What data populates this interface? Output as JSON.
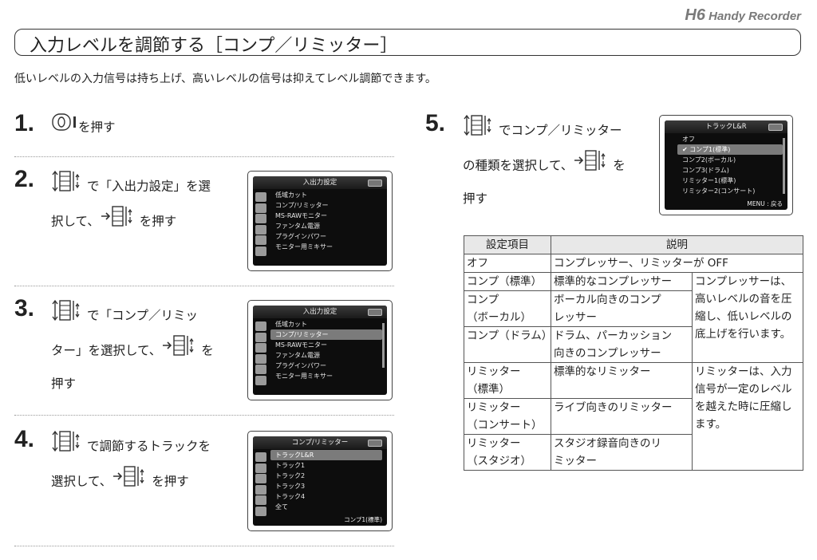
{
  "brand": {
    "model": "H6",
    "name": "Handy Recorder"
  },
  "title": "入力レベルを調節する［コンプ／リミッター］",
  "intro": "低いレベルの入力信号は持ち上げ、高いレベルの信号は抑えてレベル調節できます。",
  "steps": [
    {
      "num": "1.",
      "lines": [
        "を押す"
      ]
    },
    {
      "num": "2.",
      "lines": [
        "で「入出力設定」を選",
        "択して、",
        "を押す"
      ]
    },
    {
      "num": "3.",
      "lines": [
        "で「コンプ／リミッ",
        "ター」を選択して、",
        "を",
        "押す"
      ]
    },
    {
      "num": "4.",
      "lines": [
        "で調節するトラックを",
        "選択して、",
        "を押す"
      ]
    },
    {
      "num": "5.",
      "lines": [
        "でコンプ／リミッター",
        "の種類を選択して、",
        "を",
        "押す"
      ]
    }
  ],
  "screens": {
    "s2": {
      "title": "入出力設定",
      "items": [
        "低域カット",
        "コンプ/リミッター",
        "MS-RAWモニター",
        "ファンタム電源",
        "プラグインパワー",
        "モニター用ミキサー"
      ]
    },
    "s3": {
      "title": "入出力設定",
      "items": [
        "低域カット",
        "コンプ/リミッター",
        "MS-RAWモニター",
        "ファンタム電源",
        "プラグインパワー",
        "モニター用ミキサー"
      ]
    },
    "s4": {
      "title": "コンプ/リミッター",
      "items": [
        "トラックL&R",
        "トラック1",
        "トラック2",
        "トラック3",
        "トラック4",
        "全て"
      ],
      "footer": "コンプ1(標準)"
    },
    "s5": {
      "title": "トラックL&R",
      "items": [
        "オフ",
        "コンプ1(標準)",
        "コンプ2(ボーカル)",
        "コンプ3(ドラム)",
        "リミッター1(標準)",
        "リミッター2(コンサート)"
      ],
      "footer": "MENU : 戻る"
    }
  },
  "table": {
    "headers": [
      "設定項目",
      "説明"
    ],
    "off": [
      "オフ",
      "コンプレッサー、リミッターが OFF"
    ],
    "comp": [
      {
        "item1": "コンプ（標準）",
        "item2": "",
        "desc1": "標準的なコンプレッサー",
        "desc2": ""
      },
      {
        "item1": "コンプ",
        "item2": "（ボーカル）",
        "desc1": "ボーカル向きのコンプ",
        "desc2": "レッサー"
      },
      {
        "item1": "コンプ（ドラム）",
        "item2": "",
        "desc1": "ドラム、パーカッション",
        "desc2": "向きのコンプレッサー"
      }
    ],
    "comp_note": [
      "コンプレッサーは、",
      "高いレベルの音を圧",
      "縮し、低いレベルの",
      "底上げを行います。"
    ],
    "lim": [
      {
        "item1": "リミッター",
        "item2": "（標準）",
        "desc1": "標準的なリミッター",
        "desc2": ""
      },
      {
        "item1": "リミッター",
        "item2": "（コンサート）",
        "desc1": "ライブ向きのリミッター",
        "desc2": ""
      },
      {
        "item1": "リミッター",
        "item2": "（スタジオ）",
        "desc1": "スタジオ録音向きのリ",
        "desc2": "ミッター"
      }
    ],
    "lim_note": [
      "リミッターは、入力",
      "信号が一定のレベル",
      "を越えた時に圧縮し",
      "ます。"
    ]
  }
}
